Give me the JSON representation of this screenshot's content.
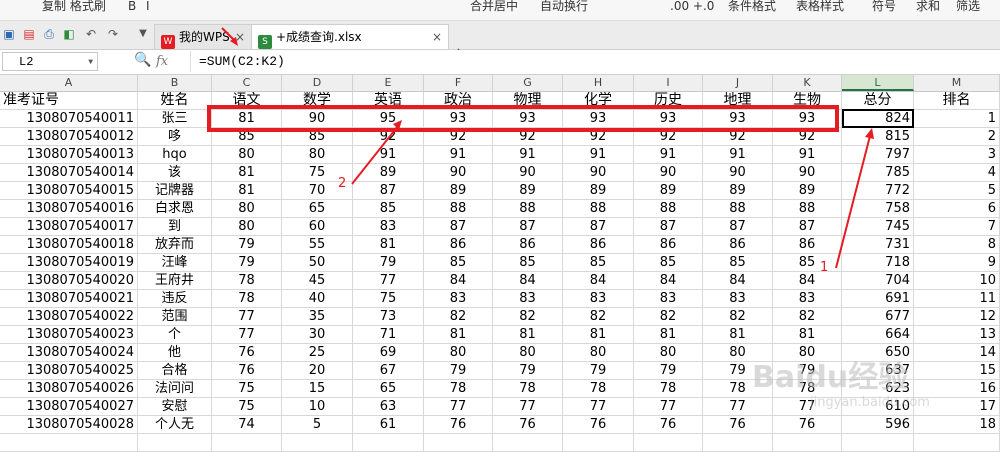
{
  "ribbon": {
    "items": [
      "复制 格式刷",
      "B",
      "I",
      "合并居中",
      "自动换行",
      ".00 +.0",
      "条件格式",
      "表格样式",
      "符号",
      "求和",
      "筛选"
    ]
  },
  "tabbar": {
    "tabs": [
      {
        "label": "我的WPS",
        "close": "×",
        "icon_color": "#e51c23",
        "icon_text": "W",
        "active": false
      },
      {
        "label": "+成绩查询.xlsx",
        "close": "×",
        "icon_color": "#2e8b3d",
        "icon_text": "S",
        "active": true
      }
    ],
    "add_label": "+"
  },
  "formula_bar": {
    "cell_ref": "L2",
    "fx_label": "fx",
    "formula": "=SUM(C2:K2)"
  },
  "sheet": {
    "columns": [
      "A",
      "B",
      "C",
      "D",
      "E",
      "F",
      "G",
      "H",
      "I",
      "J",
      "K",
      "L",
      "M"
    ],
    "selected_column": "L",
    "selected_cell": "L2",
    "headers": [
      "准考证号",
      "姓名",
      "语文",
      "数学",
      "英语",
      "政治",
      "物理",
      "化学",
      "历史",
      "地理",
      "生物",
      "总分",
      "排名"
    ],
    "rows": [
      [
        "1308070540011",
        "张三",
        "81",
        "90",
        "95",
        "93",
        "93",
        "93",
        "93",
        "93",
        "93",
        "824",
        "1"
      ],
      [
        "1308070540012",
        "哆",
        "85",
        "85",
        "92",
        "92",
        "92",
        "92",
        "92",
        "92",
        "92",
        "815",
        "2"
      ],
      [
        "1308070540013",
        "hqo",
        "80",
        "80",
        "91",
        "91",
        "91",
        "91",
        "91",
        "91",
        "91",
        "797",
        "3"
      ],
      [
        "1308070540014",
        "该",
        "81",
        "75",
        "89",
        "90",
        "90",
        "90",
        "90",
        "90",
        "90",
        "785",
        "4"
      ],
      [
        "1308070540015",
        "记牌器",
        "81",
        "70",
        "87",
        "89",
        "89",
        "89",
        "89",
        "89",
        "89",
        "772",
        "5"
      ],
      [
        "1308070540016",
        "白求恩",
        "80",
        "65",
        "85",
        "88",
        "88",
        "88",
        "88",
        "88",
        "88",
        "758",
        "6"
      ],
      [
        "1308070540017",
        "到",
        "80",
        "60",
        "83",
        "87",
        "87",
        "87",
        "87",
        "87",
        "87",
        "745",
        "7"
      ],
      [
        "1308070540018",
        "放弃而",
        "79",
        "55",
        "81",
        "86",
        "86",
        "86",
        "86",
        "86",
        "86",
        "731",
        "8"
      ],
      [
        "1308070540019",
        "汪峰",
        "79",
        "50",
        "79",
        "85",
        "85",
        "85",
        "85",
        "85",
        "85",
        "718",
        "9"
      ],
      [
        "1308070540020",
        "王府井",
        "78",
        "45",
        "77",
        "84",
        "84",
        "84",
        "84",
        "84",
        "84",
        "704",
        "10"
      ],
      [
        "1308070540021",
        "违反",
        "78",
        "40",
        "75",
        "83",
        "83",
        "83",
        "83",
        "83",
        "83",
        "691",
        "11"
      ],
      [
        "1308070540022",
        "范围",
        "77",
        "35",
        "73",
        "82",
        "82",
        "82",
        "82",
        "82",
        "82",
        "677",
        "12"
      ],
      [
        "1308070540023",
        "个",
        "77",
        "30",
        "71",
        "81",
        "81",
        "81",
        "81",
        "81",
        "81",
        "664",
        "13"
      ],
      [
        "1308070540024",
        "他",
        "76",
        "25",
        "69",
        "80",
        "80",
        "80",
        "80",
        "80",
        "80",
        "650",
        "14"
      ],
      [
        "1308070540025",
        "合格",
        "76",
        "20",
        "67",
        "79",
        "79",
        "79",
        "79",
        "79",
        "79",
        "637",
        "15"
      ],
      [
        "1308070540026",
        "法问问",
        "75",
        "15",
        "65",
        "78",
        "78",
        "78",
        "78",
        "78",
        "78",
        "623",
        "16"
      ],
      [
        "1308070540027",
        "安慰",
        "75",
        "10",
        "63",
        "77",
        "77",
        "77",
        "77",
        "77",
        "77",
        "610",
        "17"
      ],
      [
        "1308070540028",
        "个人无",
        "74",
        "5",
        "61",
        "76",
        "76",
        "76",
        "76",
        "76",
        "76",
        "596",
        "18"
      ]
    ]
  },
  "annotations": {
    "label_1": "1",
    "label_2": "2",
    "color": "#e51c23"
  },
  "watermark": {
    "brand": "Baidu经验",
    "url": "jingyan.baidu.com"
  }
}
